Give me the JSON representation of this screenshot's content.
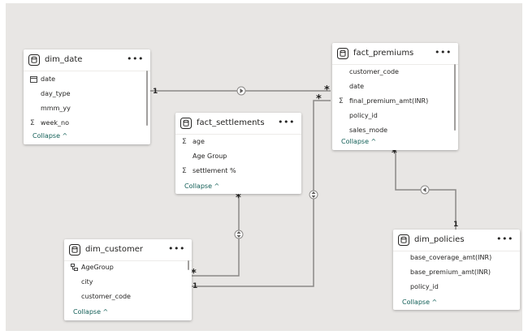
{
  "tables": {
    "dim_date": {
      "title": "dim_date",
      "fields": [
        {
          "icon": "calendar-icon",
          "name": "date"
        },
        {
          "icon": "",
          "name": "day_type"
        },
        {
          "icon": "",
          "name": "mmm_yy"
        },
        {
          "icon": "sigma-icon",
          "name": "week_no"
        }
      ],
      "collapse": "Collapse"
    },
    "fact_premiums": {
      "title": "fact_premiums",
      "fields": [
        {
          "icon": "",
          "name": "customer_code"
        },
        {
          "icon": "",
          "name": "date"
        },
        {
          "icon": "sigma-icon",
          "name": "final_premium_amt(INR)"
        },
        {
          "icon": "",
          "name": "policy_id"
        },
        {
          "icon": "",
          "name": "sales_mode"
        }
      ],
      "collapse": "Collapse"
    },
    "fact_settlements": {
      "title": "fact_settlements",
      "fields": [
        {
          "icon": "sigma-icon",
          "name": "age"
        },
        {
          "icon": "",
          "name": "Age Group"
        },
        {
          "icon": "sigma-icon",
          "name": "settlement %"
        }
      ],
      "collapse": "Collapse"
    },
    "dim_customer": {
      "title": "dim_customer",
      "fields": [
        {
          "icon": "hierarchy-icon",
          "name": "AgeGroup"
        },
        {
          "icon": "",
          "name": "city"
        },
        {
          "icon": "",
          "name": "customer_code"
        }
      ],
      "collapse": "Collapse"
    },
    "dim_policies": {
      "title": "dim_policies",
      "fields": [
        {
          "icon": "",
          "name": "base_coverage_amt(INR)"
        },
        {
          "icon": "",
          "name": "base_premium_amt(INR)"
        },
        {
          "icon": "",
          "name": "policy_id"
        }
      ],
      "collapse": "Collapse"
    }
  },
  "ui": {
    "more_label": "•••",
    "collapse_caret": "^"
  },
  "cardinality": {
    "one": "1",
    "many": "*"
  },
  "colors": {
    "canvas": "#e8e6e4",
    "line": "#8a8886",
    "collapse_link": "#115e56"
  }
}
